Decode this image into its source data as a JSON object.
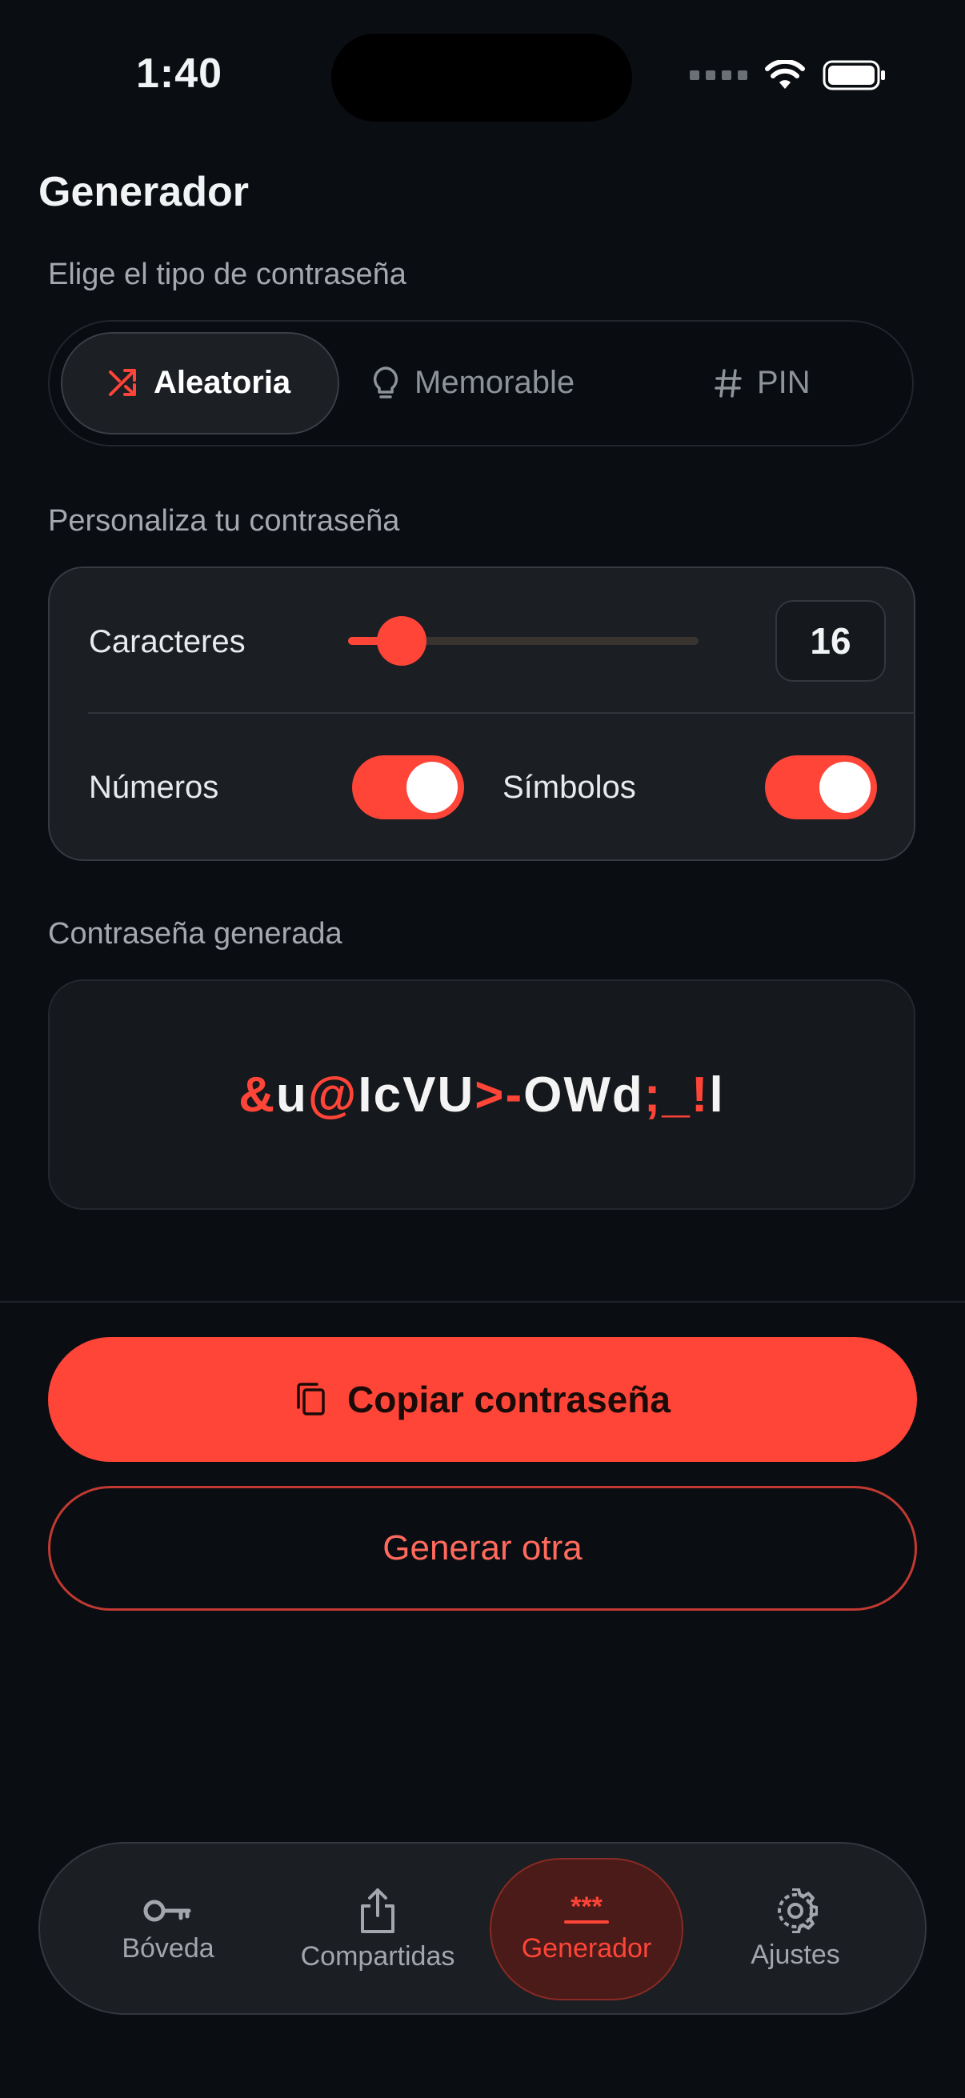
{
  "status_bar": {
    "time": "1:40"
  },
  "header": {
    "title": "Generador"
  },
  "password_type": {
    "label": "Elige el tipo de contraseña",
    "options": [
      {
        "label": "Aleatoria",
        "icon": "shuffle-icon",
        "selected": true
      },
      {
        "label": "Memorable",
        "icon": "lightbulb-icon",
        "selected": false
      },
      {
        "label": "PIN",
        "icon": "hash-icon",
        "selected": false
      }
    ]
  },
  "customize": {
    "label": "Personaliza tu contraseña",
    "characters_label": "Caracteres",
    "characters_value": "16",
    "numbers_label": "Números",
    "numbers_on": true,
    "symbols_label": "Símbolos",
    "symbols_on": true
  },
  "generated": {
    "label": "Contraseña generada",
    "password": "&u@IcVU>-OWd;_!l",
    "segments": [
      {
        "text": "&",
        "type": "symbol"
      },
      {
        "text": "u",
        "type": "letter"
      },
      {
        "text": "@",
        "type": "symbol"
      },
      {
        "text": "IcVU",
        "type": "letter"
      },
      {
        "text": ">-",
        "type": "symbol"
      },
      {
        "text": "OWd",
        "type": "letter"
      },
      {
        "text": ";_!",
        "type": "symbol"
      },
      {
        "text": "l",
        "type": "letter"
      }
    ]
  },
  "actions": {
    "copy_label": "Copiar contraseña",
    "regenerate_label": "Generar otra"
  },
  "tabbar": {
    "items": [
      {
        "label": "Bóveda",
        "icon": "key-icon",
        "active": false
      },
      {
        "label": "Compartidas",
        "icon": "share-icon",
        "active": false
      },
      {
        "label": "Generador",
        "icon": "asterisks-icon",
        "active": true
      },
      {
        "label": "Ajustes",
        "icon": "gear-icon",
        "active": false
      }
    ]
  },
  "colors": {
    "accent": "#ff4438",
    "background": "#0a0d12",
    "card": "#1b1e23"
  }
}
